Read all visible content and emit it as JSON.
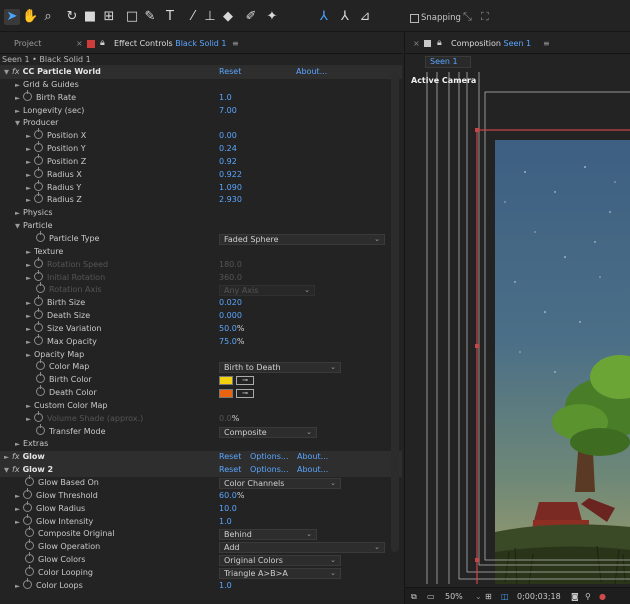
{
  "toolbar": {
    "tools": [
      "selection",
      "hand",
      "zoom",
      "orbit",
      "track",
      "pan-behind",
      "rectangle",
      "pen",
      "type",
      "brush",
      "clone-stamp",
      "eraser",
      "roto-brush",
      "puppet-pin",
      "local-axis",
      "world-axis",
      "view-axis"
    ],
    "snapping_label": "Snapping"
  },
  "left_panel": {
    "tabs": {
      "project": "Project",
      "effect_controls_prefix": "Effect Controls",
      "effect_controls_layer": "Black Solid 1",
      "menu": "≡"
    },
    "breadcrumb": "Seen 1 • Black Solid 1",
    "rows": [
      {
        "indent": 0,
        "twirl": "▼",
        "fx": true,
        "name": "CC Particle World",
        "bold": true,
        "links": [
          "Reset",
          "About..."
        ]
      },
      {
        "indent": 1,
        "twirl": "►",
        "name": "Grid & Guides"
      },
      {
        "indent": 1,
        "twirl": "►",
        "stopwatch": true,
        "name": "Birth Rate",
        "value": "1.0"
      },
      {
        "indent": 1,
        "twirl": "►",
        "name": "Longevity (sec)",
        "value": "7.00"
      },
      {
        "indent": 1,
        "twirl": "▼",
        "name": "Producer"
      },
      {
        "indent": 2,
        "twirl": "►",
        "stopwatch": true,
        "name": "Position X",
        "value": "0.00"
      },
      {
        "indent": 2,
        "twirl": "►",
        "stopwatch": true,
        "name": "Position Y",
        "value": "0.24"
      },
      {
        "indent": 2,
        "twirl": "►",
        "stopwatch": true,
        "name": "Position Z",
        "value": "0.92"
      },
      {
        "indent": 2,
        "twirl": "►",
        "stopwatch": true,
        "name": "Radius X",
        "value": "0.922"
      },
      {
        "indent": 2,
        "twirl": "►",
        "stopwatch": true,
        "name": "Radius Y",
        "value": "1.090"
      },
      {
        "indent": 2,
        "twirl": "►",
        "stopwatch": true,
        "name": "Radius Z",
        "value": "2.930"
      },
      {
        "indent": 1,
        "twirl": "►",
        "name": "Physics"
      },
      {
        "indent": 1,
        "twirl": "▼",
        "name": "Particle"
      },
      {
        "indent": 2,
        "stopwatch": true,
        "name": "Particle Type",
        "dropdown": "Faded Sphere",
        "dd_width": 166
      },
      {
        "indent": 2,
        "twirl": "►",
        "name": "Texture"
      },
      {
        "indent": 2,
        "twirl": "►",
        "stopwatch": true,
        "name": "Rotation Speed",
        "value": "180.0",
        "dim": true
      },
      {
        "indent": 2,
        "twirl": "►",
        "stopwatch": true,
        "name": "Initial Rotation",
        "value": "360.0",
        "dim": true
      },
      {
        "indent": 2,
        "stopwatch": true,
        "name": "Rotation Axis",
        "dropdown": "Any Axis",
        "dd_width": 96,
        "dim": true
      },
      {
        "indent": 2,
        "twirl": "►",
        "stopwatch": true,
        "name": "Birth Size",
        "value": "0.020"
      },
      {
        "indent": 2,
        "twirl": "►",
        "stopwatch": true,
        "name": "Death Size",
        "value": "0.000"
      },
      {
        "indent": 2,
        "twirl": "►",
        "stopwatch": true,
        "name": "Size Variation",
        "value": "50.0",
        "unit": "%"
      },
      {
        "indent": 2,
        "twirl": "►",
        "stopwatch": true,
        "name": "Max Opacity",
        "value": "75.0",
        "unit": "%"
      },
      {
        "indent": 2,
        "twirl": "►",
        "name": "Opacity Map"
      },
      {
        "indent": 2,
        "stopwatch": true,
        "name": "Color Map",
        "dropdown": "Birth to Death",
        "dd_width": 122
      },
      {
        "indent": 2,
        "stopwatch": true,
        "name": "Birth Color",
        "color": "#f2d20f"
      },
      {
        "indent": 2,
        "stopwatch": true,
        "name": "Death Color",
        "color": "#ea6410"
      },
      {
        "indent": 2,
        "twirl": "►",
        "name": "Custom Color Map"
      },
      {
        "indent": 2,
        "twirl": "►",
        "stopwatch": true,
        "name": "Volume Shade (approx.)",
        "value": "0.0",
        "unit": "%",
        "dim": true
      },
      {
        "indent": 2,
        "stopwatch": true,
        "name": "Transfer Mode",
        "dropdown": "Composite",
        "dd_width": 98
      },
      {
        "indent": 1,
        "twirl": "►",
        "name": "Extras"
      },
      {
        "indent": 0,
        "twirl": "►",
        "fx": true,
        "name": "Glow",
        "bold": true,
        "links": [
          "Reset",
          "Options...",
          "About..."
        ]
      },
      {
        "indent": 0,
        "twirl": "▼",
        "fx": true,
        "name": "Glow 2",
        "bold": true,
        "links": [
          "Reset",
          "Options...",
          "About..."
        ]
      },
      {
        "indent": 1,
        "stopwatch": true,
        "name": "Glow Based On",
        "dropdown": "Color Channels",
        "dd_width": 122
      },
      {
        "indent": 1,
        "twirl": "►",
        "stopwatch": true,
        "name": "Glow Threshold",
        "value": "60.0",
        "unit": "%"
      },
      {
        "indent": 1,
        "twirl": "►",
        "stopwatch": true,
        "name": "Glow Radius",
        "value": "10.0"
      },
      {
        "indent": 1,
        "twirl": "►",
        "stopwatch": true,
        "name": "Glow Intensity",
        "value": "1.0"
      },
      {
        "indent": 1,
        "stopwatch": true,
        "name": "Composite Original",
        "dropdown": "Behind",
        "dd_width": 98
      },
      {
        "indent": 1,
        "stopwatch": true,
        "name": "Glow Operation",
        "dropdown": "Add",
        "dd_width": 166
      },
      {
        "indent": 1,
        "stopwatch": true,
        "name": "Glow Colors",
        "dropdown": "Original Colors",
        "dd_width": 122
      },
      {
        "indent": 1,
        "stopwatch": true,
        "name": "Color Looping",
        "dropdown": "Triangle A>B>A",
        "dd_width": 122
      },
      {
        "indent": 1,
        "twirl": "►",
        "stopwatch": true,
        "name": "Color Loops",
        "value": "1.0"
      }
    ]
  },
  "right_panel": {
    "tab_prefix": "Composition",
    "tab_name": "Seen 1",
    "menu": "≡",
    "subtab": "Seen 1",
    "camera_label": "Active Camera",
    "status": {
      "zoom": "50%",
      "timecode": "0;00;03;18"
    }
  },
  "colors": {
    "accent_blue": "#5aa6ff",
    "birth_color": "#f2d20f",
    "death_color": "#ea6410",
    "guide_red": "#c94545"
  }
}
